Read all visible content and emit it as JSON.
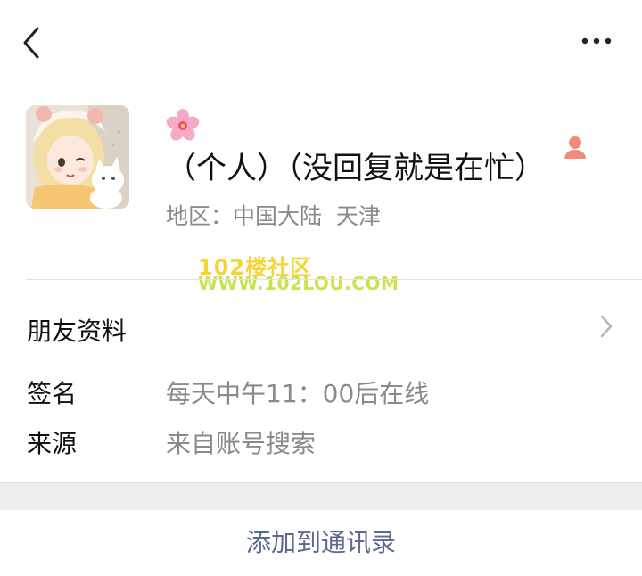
{
  "nav": {
    "back_icon": "chevron-left-icon",
    "more_icon": "more-dots-icon"
  },
  "profile": {
    "display_name": "（个人）（没回复就是在忙）",
    "name_emoji": "cherry-blossom-icon",
    "gender_icon": "female-person-icon",
    "region": "地区：中国大陆  天津"
  },
  "watermark": {
    "line1": "102楼社区",
    "line2": "WWW.102LOU.COM"
  },
  "friend_info": {
    "label": "朋友资料"
  },
  "signature": {
    "label": "签名",
    "value": "每天中午11：00后在线"
  },
  "source": {
    "label": "来源",
    "value": "来自账号搜索"
  },
  "footer": {
    "add_label": "添加到通讯录"
  },
  "colors": {
    "accent": "#5b6a92",
    "secondary_text": "#8a8a8a",
    "gender": "#f08c7c"
  }
}
